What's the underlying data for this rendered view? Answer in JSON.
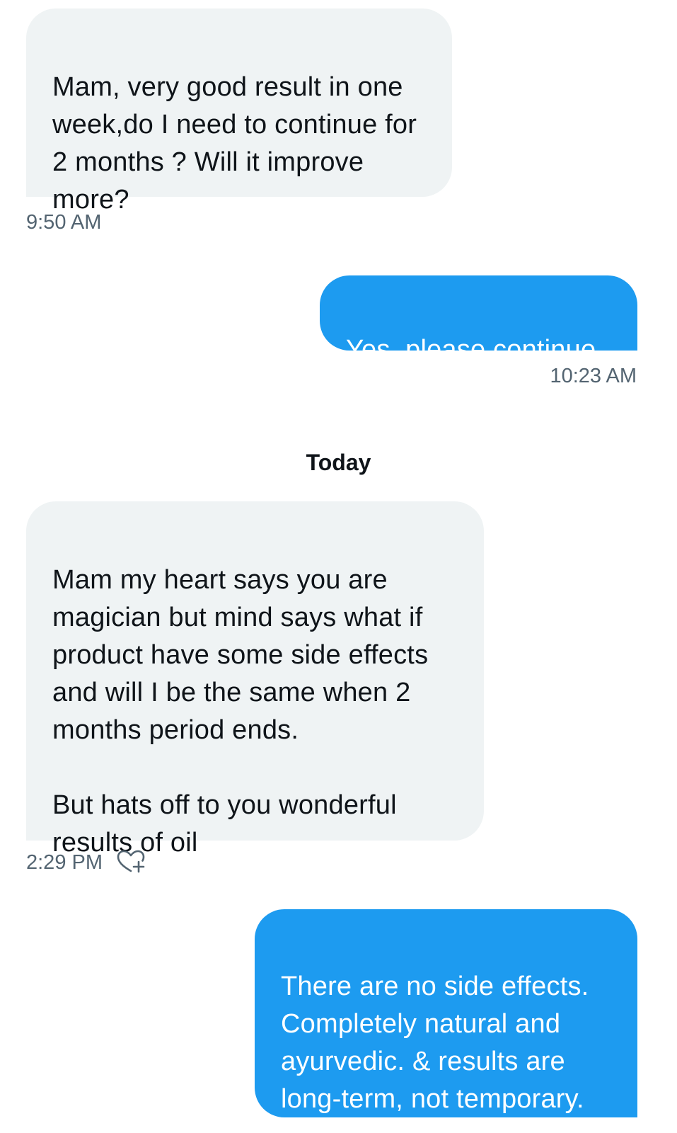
{
  "conversation": {
    "messages": [
      {
        "direction": "incoming",
        "text": "Mam, very good result in one week,do I need to continue for 2 months ? Will it improve more?",
        "time": "9:50 AM"
      },
      {
        "direction": "outgoing",
        "text": "Yes, please continue",
        "time": "10:23 AM"
      },
      {
        "direction": "incoming",
        "text": "Mam my heart says you are magician but mind says what if product have some side effects and will I be the same  when 2 months period ends.\n\nBut hats off to you wonderful results of oil",
        "time": "2:29 PM"
      },
      {
        "direction": "outgoing",
        "text": "There are no side effects. Completely natural and ayurvedic. & results are long-term, not temporary."
      }
    ],
    "date_divider": "Today",
    "react_icon": "heart-plus-icon"
  },
  "colors": {
    "incoming_bubble": "#eff3f4",
    "outgoing_bubble": "#1d9bf0",
    "timestamp": "#536471",
    "text": "#0f1419"
  }
}
